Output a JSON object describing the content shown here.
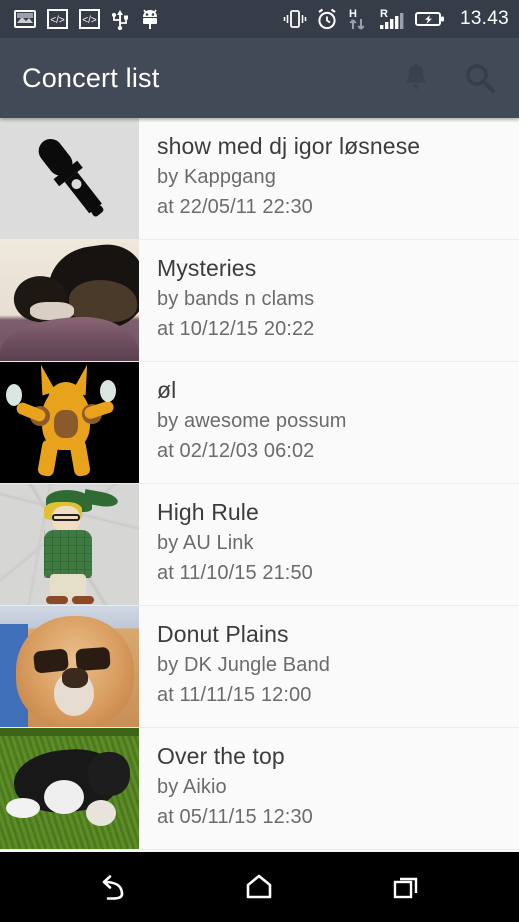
{
  "status_bar": {
    "time": "13.43",
    "left_icons": [
      {
        "name": "screenshot-icon",
        "label": "screenshot"
      },
      {
        "name": "developer-code-icon-1",
        "label": "</>"
      },
      {
        "name": "developer-code-icon-2",
        "label": "</>"
      },
      {
        "name": "usb-icon",
        "label": "usb"
      },
      {
        "name": "android-debug-icon",
        "label": "android"
      }
    ],
    "right_icons": [
      {
        "name": "vibrate-icon",
        "label": "vibrate"
      },
      {
        "name": "alarm-clock-icon",
        "label": "alarm"
      },
      {
        "name": "hspa-data-icon",
        "label": "H"
      },
      {
        "name": "roaming-signal-icon",
        "label": "R"
      },
      {
        "name": "battery-charging-icon",
        "label": "charging"
      }
    ],
    "background": "#363c48"
  },
  "app_bar": {
    "title": "Concert list",
    "background": "#434a57",
    "title_color": "#ffffff",
    "actions": [
      {
        "name": "notifications-icon",
        "label": "Notifications"
      },
      {
        "name": "search-icon",
        "label": "Search"
      }
    ]
  },
  "list": {
    "items": [
      {
        "title": "show med dj igor løsnese",
        "by": "by Kappgang",
        "at": "at 22/05/11 22:30",
        "thumb": "microphone-placeholder"
      },
      {
        "title": "Mysteries",
        "by": "by bands n clams",
        "at": "at 10/12/15 20:22",
        "thumb": "dog-and-pup-photo"
      },
      {
        "title": "øl",
        "by": "by awesome possum",
        "at": "at 02/12/03 06:02",
        "thumb": "alakazam-artwork"
      },
      {
        "title": "High Rule",
        "by": "by AU Link",
        "at": "at 11/10/15 21:50",
        "thumb": "hipster-link-artwork"
      },
      {
        "title": "Donut Plains",
        "by": "by DK Jungle Band",
        "at": "at 11/11/15 12:00",
        "thumb": "dog-sunglasses-photo"
      },
      {
        "title": "Over the top",
        "by": "by Aikio",
        "at": "at 05/11/15 12:30",
        "thumb": "dog-on-grass-photo"
      }
    ],
    "background": "#fafafa",
    "divider_color": "#ececed",
    "title_color": "#3c3c3c",
    "meta_color": "#6b6b6b"
  },
  "nav_bar": {
    "background": "#000000",
    "buttons": [
      {
        "name": "back-button",
        "label": "Back"
      },
      {
        "name": "home-button",
        "label": "Home"
      },
      {
        "name": "recents-button",
        "label": "Recent apps"
      }
    ]
  }
}
